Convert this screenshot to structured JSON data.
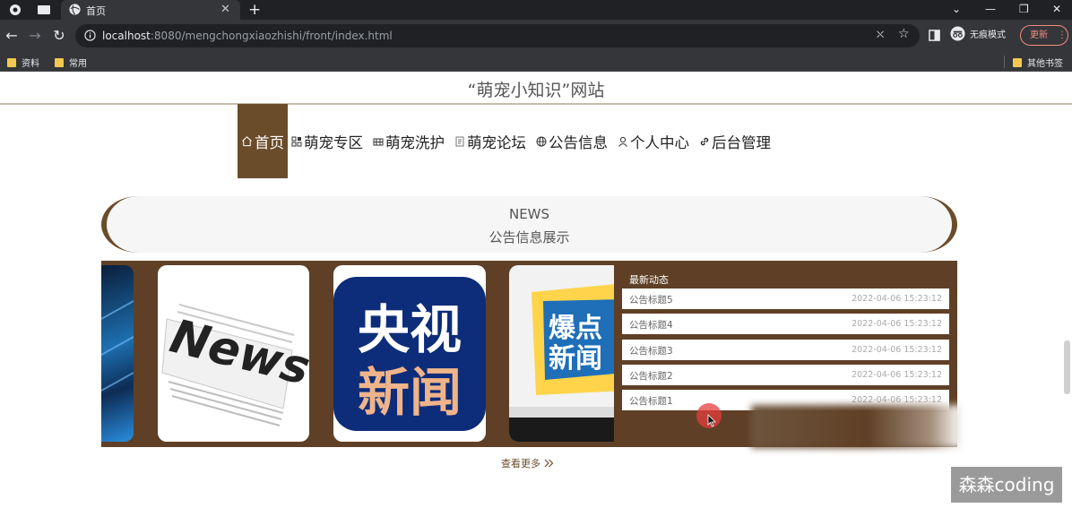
{
  "browser": {
    "tab_title": "首页",
    "url_host": "localhost",
    "url_rest": ":8080/mengchongxiaozhishi/front/index.html",
    "incognito_label": "无痕模式",
    "update_label": "更新",
    "bookmarks": [
      "资料",
      "常用"
    ],
    "other_bookmarks": "其他书签"
  },
  "site": {
    "title": "“萌宠小知识”网站",
    "nav": [
      {
        "label": "首页",
        "icon": "home-icon",
        "active": true
      },
      {
        "label": "萌宠专区",
        "icon": "grid-icon"
      },
      {
        "label": "萌宠洗护",
        "icon": "bath-icon"
      },
      {
        "label": "萌宠论坛",
        "icon": "document-icon"
      },
      {
        "label": "公告信息",
        "icon": "globe-icon"
      },
      {
        "label": "个人中心",
        "icon": "user-icon"
      },
      {
        "label": "后台管理",
        "icon": "link-icon"
      }
    ]
  },
  "news": {
    "heading_en": "NEWS",
    "heading_cn": "公告信息展示",
    "latest_title": "最新动态",
    "items": [
      {
        "title": "公告标题5",
        "date": "2022-04-06 15:23:12"
      },
      {
        "title": "公告标题4",
        "date": "2022-04-06 15:23:12"
      },
      {
        "title": "公告标题3",
        "date": "2022-04-06 15:23:12"
      },
      {
        "title": "公告标题2",
        "date": "2022-04-06 15:23:12"
      },
      {
        "title": "公告标题1",
        "date": "2022-04-06 15:23:12"
      }
    ],
    "thumb_texts": {
      "news": "News",
      "cctv_line1": "央视",
      "cctv_line2": "新闻",
      "breaking_line1": "爆点",
      "breaking_line2": "新闻"
    },
    "more_label": "查看更多"
  },
  "watermark": "森森coding",
  "colors": {
    "brand_brown": "#6b4c2a",
    "panel_brown": "#5f4026",
    "chrome_dark": "#202124"
  }
}
